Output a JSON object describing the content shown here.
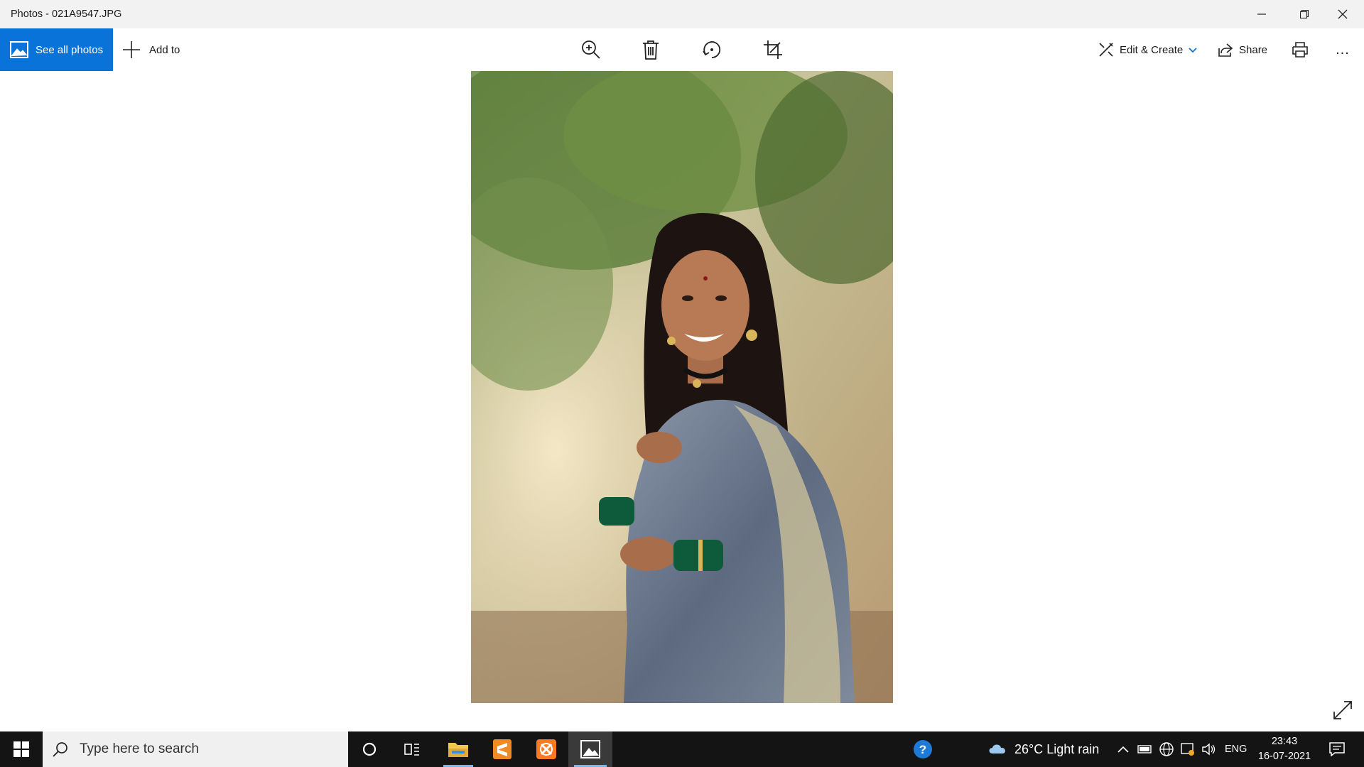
{
  "window": {
    "title": "Photos - 021A9547.JPG",
    "controls": [
      "minimize",
      "restore",
      "close"
    ]
  },
  "toolbar": {
    "see_all_label": "See all photos",
    "add_to_label": "Add to",
    "tools": [
      {
        "name": "zoom",
        "icon": "zoom-in-icon"
      },
      {
        "name": "delete",
        "icon": "trash-icon"
      },
      {
        "name": "rotate",
        "icon": "rotate-icon"
      },
      {
        "name": "crop",
        "icon": "crop-icon"
      }
    ],
    "edit_create_label": "Edit & Create",
    "share_label": "Share",
    "print_icon": "print-icon",
    "more_label": "..."
  },
  "photo": {
    "subject": "Portrait photo"
  },
  "taskbar": {
    "search_placeholder": "Type here to search",
    "apps": [
      "cortana",
      "task-view",
      "file-explorer",
      "sublime-text",
      "xampp",
      "photos"
    ],
    "weather_text": "26°C  Light rain",
    "language": "ENG",
    "time": "23:43",
    "date": "16-07-2021"
  },
  "colors": {
    "accent": "#0a73d9",
    "taskbar": "#141414",
    "titlebar": "#f2f2f2"
  }
}
